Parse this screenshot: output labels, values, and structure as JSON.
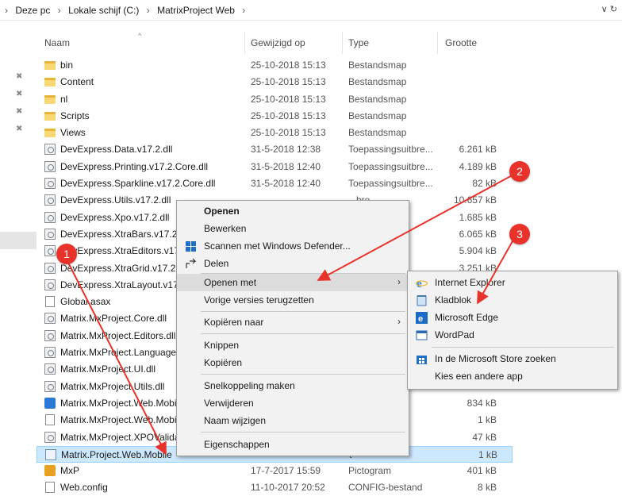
{
  "address": {
    "crumbs": [
      "Deze pc",
      "Lokale schijf (C:)",
      "MatrixProject Web"
    ],
    "separator": "›",
    "leading_arrow": "›",
    "tools": "∨ ↻"
  },
  "columns": {
    "name": "Naam",
    "date": "Gewijzigd op",
    "type": "Type",
    "size": "Grootte",
    "sort_indicator": "^"
  },
  "files": [
    {
      "name": "bin",
      "date": "25-10-2018 15:13",
      "type": "Bestandsmap",
      "size": "",
      "icon": "folder-icon"
    },
    {
      "name": "Content",
      "date": "25-10-2018 15:13",
      "type": "Bestandsmap",
      "size": "",
      "icon": "folder-icon"
    },
    {
      "name": "nl",
      "date": "25-10-2018 15:13",
      "type": "Bestandsmap",
      "size": "",
      "icon": "folder-icon"
    },
    {
      "name": "Scripts",
      "date": "25-10-2018 15:13",
      "type": "Bestandsmap",
      "size": "",
      "icon": "folder-icon"
    },
    {
      "name": "Views",
      "date": "25-10-2018 15:13",
      "type": "Bestandsmap",
      "size": "",
      "icon": "folder-icon"
    },
    {
      "name": "DevExpress.Data.v17.2.dll",
      "date": "31-5-2018 12:38",
      "type": "Toepassingsuitbre...",
      "size": "6.261 kB",
      "icon": "dll-icon"
    },
    {
      "name": "DevExpress.Printing.v17.2.Core.dll",
      "date": "31-5-2018 12:40",
      "type": "Toepassingsuitbre...",
      "size": "4.189 kB",
      "icon": "dll-icon"
    },
    {
      "name": "DevExpress.Sparkline.v17.2.Core.dll",
      "date": "31-5-2018 12:40",
      "type": "Toepassingsuitbre...",
      "size": "82 kB",
      "icon": "dll-icon"
    },
    {
      "name": "DevExpress.Utils.v17.2.dll",
      "date": "",
      "type": "...bre...",
      "size": "10.657 kB",
      "icon": "dll-icon"
    },
    {
      "name": "DevExpress.Xpo.v17.2.dll",
      "date": "",
      "type": "...bre...",
      "size": "1.685 kB",
      "icon": "dll-icon"
    },
    {
      "name": "DevExpress.XtraBars.v17.2.dll",
      "date": "",
      "type": "...bre...",
      "size": "6.065 kB",
      "icon": "dll-icon"
    },
    {
      "name": "DevExpress.XtraEditors.v17.2",
      "date": "",
      "type": "...bre...",
      "size": "5.904 kB",
      "icon": "dll-icon"
    },
    {
      "name": "DevExpress.XtraGrid.v17.2.dll",
      "date": "",
      "type": "...bre...",
      "size": "3.251 kB",
      "icon": "dll-icon"
    },
    {
      "name": "DevExpress.XtraLayout.v17.2",
      "date": "",
      "type": "",
      "size": "",
      "icon": "dll-icon"
    },
    {
      "name": "Global.asax",
      "date": "",
      "type": "",
      "size": "",
      "icon": "file-icon"
    },
    {
      "name": "Matrix.MxProject.Core.dll",
      "date": "",
      "type": "",
      "size": "",
      "icon": "dll-icon"
    },
    {
      "name": "Matrix.MxProject.Editors.dll",
      "date": "",
      "type": "",
      "size": "",
      "icon": "dll-icon"
    },
    {
      "name": "Matrix.MxProject.Language.",
      "date": "",
      "type": "",
      "size": "",
      "icon": "dll-icon"
    },
    {
      "name": "Matrix.MxProject.UI.dll",
      "date": "",
      "type": "",
      "size": "",
      "icon": "dll-icon"
    },
    {
      "name": "Matrix.MxProject.Utils.dll",
      "date": "",
      "type": "",
      "size": "",
      "icon": "dll-icon"
    },
    {
      "name": "Matrix.MxProject.Web.Mobi",
      "date": "",
      "type": "",
      "size": "834 kB",
      "icon": "web-icon"
    },
    {
      "name": "Matrix.MxProject.Web.Mobi",
      "date": "",
      "type": "nd",
      "size": "1 kB",
      "icon": "file-icon"
    },
    {
      "name": "Matrix.MxProject.XPOValida",
      "date": "",
      "type": "re...",
      "size": "47 kB",
      "icon": "dll-icon"
    },
    {
      "name": "Matrix.Project.Web.Mobile",
      "date": "",
      "type": "t",
      "size": "1 kB",
      "icon": "ico-file-icon",
      "selected": true
    },
    {
      "name": "MxP",
      "date": "17-7-2017 15:59",
      "type": "Pictogram",
      "size": "401 kB",
      "icon": "mxp-icon"
    },
    {
      "name": "Web.config",
      "date": "11-10-2017 20:52",
      "type": "CONFIG-bestand",
      "size": "8 kB",
      "icon": "file-icon"
    }
  ],
  "context_menu": {
    "open": "Openen",
    "edit": "Bewerken",
    "scan": "Scannen met Windows Defender...",
    "share": "Delen",
    "open_with": "Openen met",
    "restore": "Vorige versies terugzetten",
    "send_to": "Kopiëren naar",
    "cut": "Knippen",
    "copy": "Kopiëren",
    "shortcut": "Snelkoppeling maken",
    "delete": "Verwijderen",
    "rename": "Naam wijzigen",
    "properties": "Eigenschappen"
  },
  "submenu": {
    "ie": "Internet Explorer",
    "notepad": "Kladblok",
    "edge": "Microsoft Edge",
    "wordpad": "WordPad",
    "store": "In de Microsoft Store zoeken",
    "other": "Kies een andere app"
  },
  "badges": {
    "b1": "1",
    "b2": "2",
    "b3": "3"
  },
  "colors": {
    "accent": "#e8322a",
    "selection": "#cce8ff",
    "menu_bg": "#f2f2f2"
  }
}
